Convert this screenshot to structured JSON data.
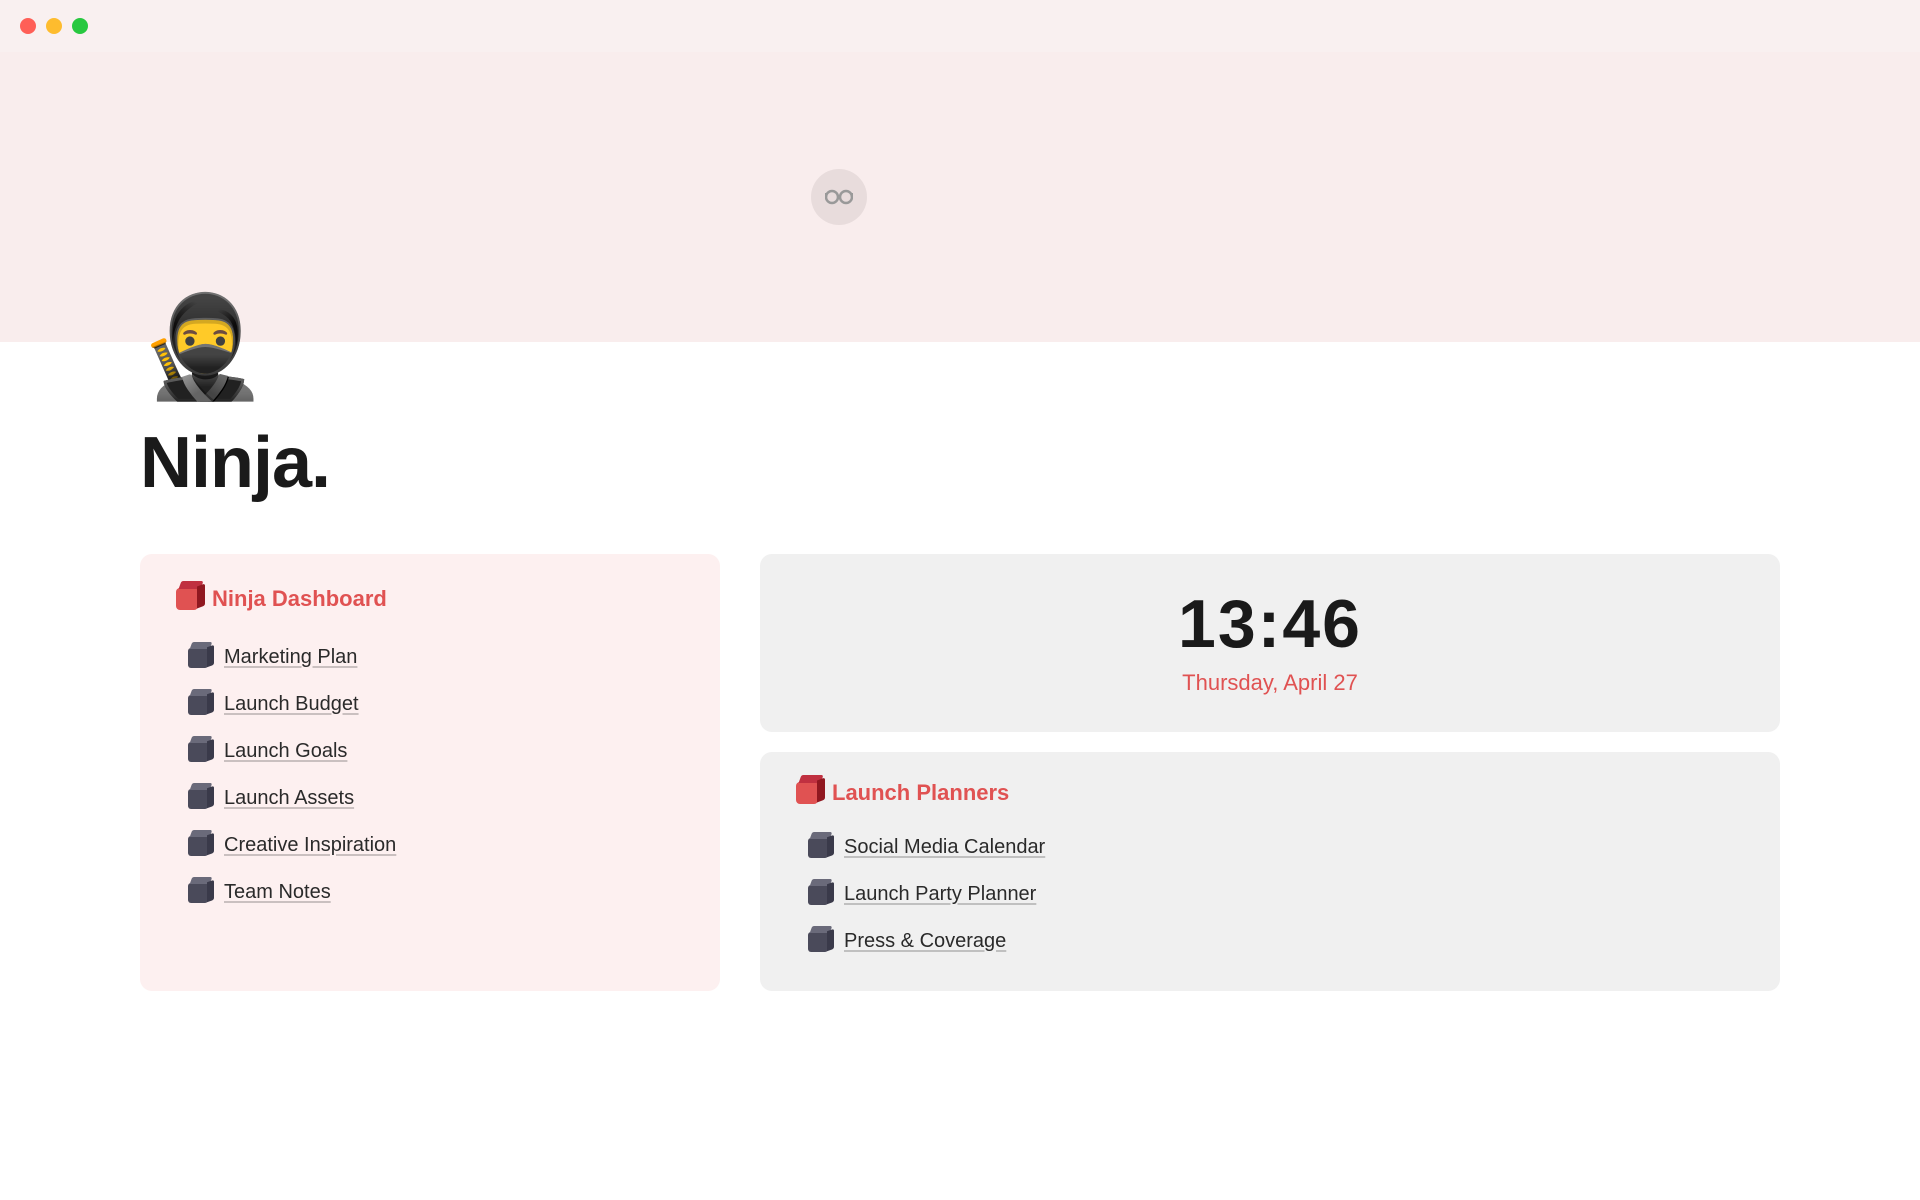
{
  "titlebar": {
    "traffic_lights": [
      "red",
      "yellow",
      "green"
    ]
  },
  "hero": {
    "background_color": "#f9eded",
    "glasses_icon": "👓"
  },
  "page": {
    "emoji": "🥷",
    "title": "Ninja."
  },
  "nav_panel": {
    "header_word1": "Ninja",
    "header_word2": "Dashboard",
    "items": [
      {
        "label": "Marketing Plan"
      },
      {
        "label": "Launch Budget"
      },
      {
        "label": "Launch Goals"
      },
      {
        "label": "Launch Assets"
      },
      {
        "label": "Creative Inspiration"
      },
      {
        "label": "Team Notes"
      }
    ]
  },
  "clock": {
    "time": "13:46",
    "date": "Thursday, April 27"
  },
  "planners": {
    "header_word1": "Launch",
    "header_word2": "Planners",
    "items": [
      {
        "label": "Social Media Calendar"
      },
      {
        "label": "Launch Party Planner"
      },
      {
        "label": "Press & Coverage"
      }
    ]
  }
}
